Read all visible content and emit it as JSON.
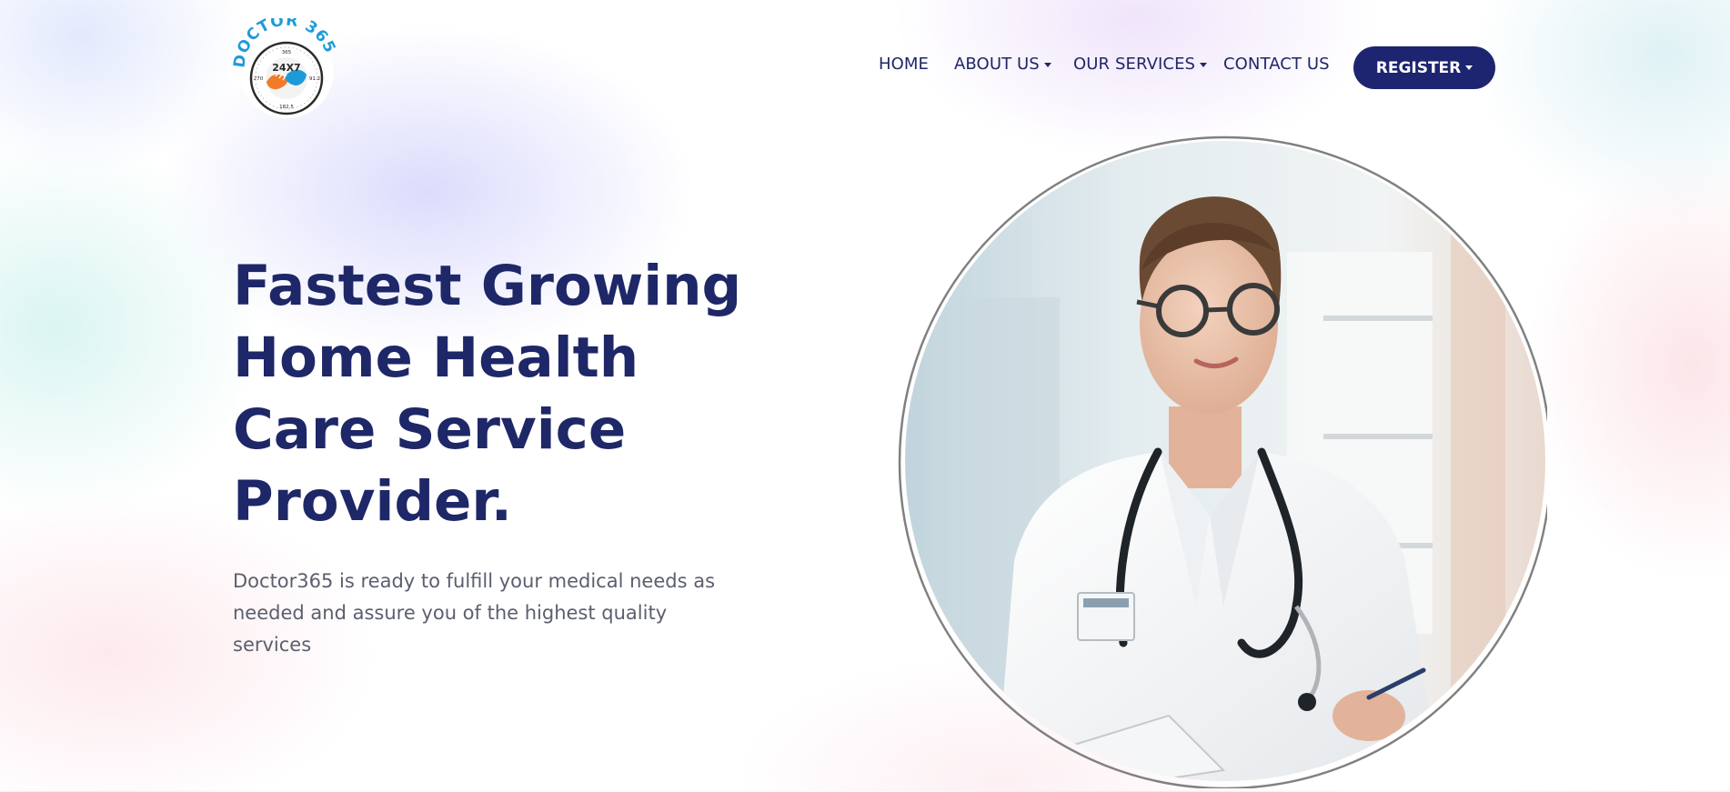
{
  "logo": {
    "brand_text": "DOCTOR 365",
    "center_text": "24X7",
    "dial_top": "365",
    "dial_left": "270",
    "dial_right": "91.2",
    "dial_bottom": "182.5",
    "colors": {
      "blue": "#1e9bd7",
      "orange": "#f07c2a",
      "dark": "#2a2a2a"
    }
  },
  "nav": {
    "items": [
      {
        "label": "HOME",
        "has_dropdown": false
      },
      {
        "label": "ABOUT US",
        "has_dropdown": true
      },
      {
        "label": "OUR SERVICES",
        "has_dropdown": true
      },
      {
        "label": "CONTACT US",
        "has_dropdown": false
      }
    ],
    "register_label": "REGISTER"
  },
  "hero": {
    "headline_lines": [
      "Fastest Growing",
      "Home Health",
      "Care Service",
      "Provider."
    ],
    "subtext": "Doctor365 is ready to fulfill your medical needs as needed and assure you of the highest quality services"
  },
  "colors": {
    "primary": "#1e2767",
    "button": "#1d2470",
    "body_text": "#5b5f6e"
  },
  "icons": {
    "dropdown": "caret-down-icon"
  }
}
